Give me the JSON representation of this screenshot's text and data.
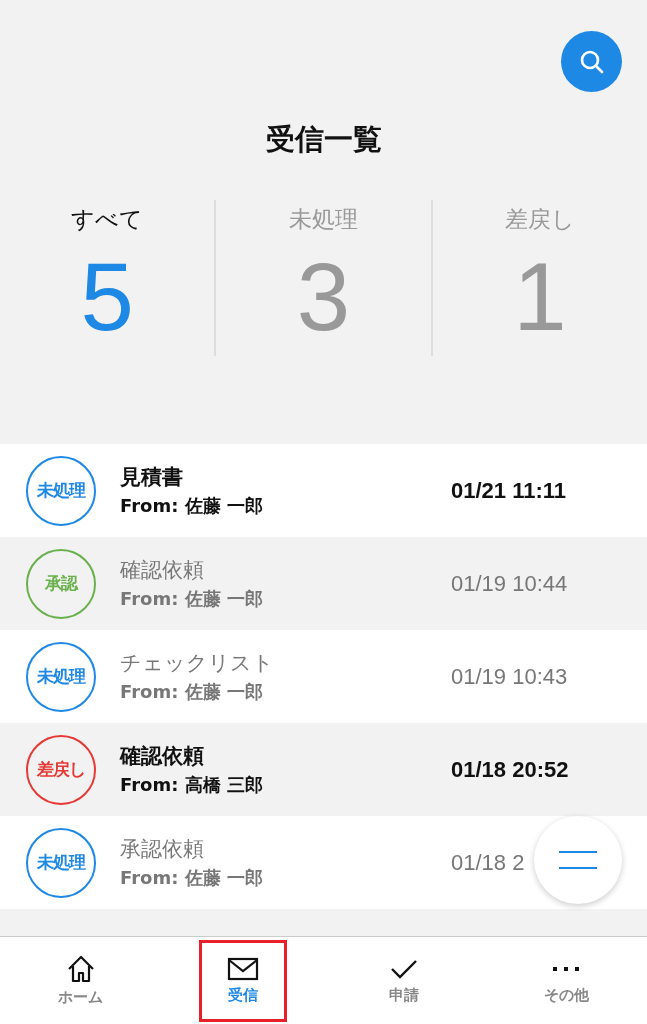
{
  "header": {
    "title": "受信一覧"
  },
  "stats": [
    {
      "label": "すべて",
      "count": "5",
      "selected": true
    },
    {
      "label": "未処理",
      "count": "3",
      "selected": false
    },
    {
      "label": "差戻し",
      "count": "1",
      "selected": false
    }
  ],
  "messages": [
    {
      "status": "未処理",
      "color": "#1e88e5",
      "title": "見積書",
      "from": "From: 佐藤 一郎",
      "date": "01/21 11:11",
      "unread": true
    },
    {
      "status": "承認",
      "color": "#6ab04c",
      "title": "確認依頼",
      "from": "From: 佐藤 一郎",
      "date": "01/19 10:44",
      "unread": false
    },
    {
      "status": "未処理",
      "color": "#1e88e5",
      "title": "チェックリスト",
      "from": "From: 佐藤 一郎",
      "date": "01/19 10:43",
      "unread": false
    },
    {
      "status": "差戻し",
      "color": "#e53935",
      "title": "確認依頼",
      "from": "From: 高橋 三郎",
      "date": "01/18 20:52",
      "unread": true
    },
    {
      "status": "未処理",
      "color": "#1e88e5",
      "title": "承認依頼",
      "from": "From: 佐藤 一郎",
      "date": "01/18 2",
      "unread": false
    }
  ],
  "bottom_nav": [
    {
      "kind": "home",
      "label": "ホーム",
      "selected": false,
      "highlighted": false
    },
    {
      "kind": "mail",
      "label": "受信",
      "selected": true,
      "highlighted": true
    },
    {
      "kind": "check",
      "label": "申請",
      "selected": false,
      "highlighted": false
    },
    {
      "kind": "more",
      "label": "その他",
      "selected": false,
      "highlighted": false
    }
  ]
}
